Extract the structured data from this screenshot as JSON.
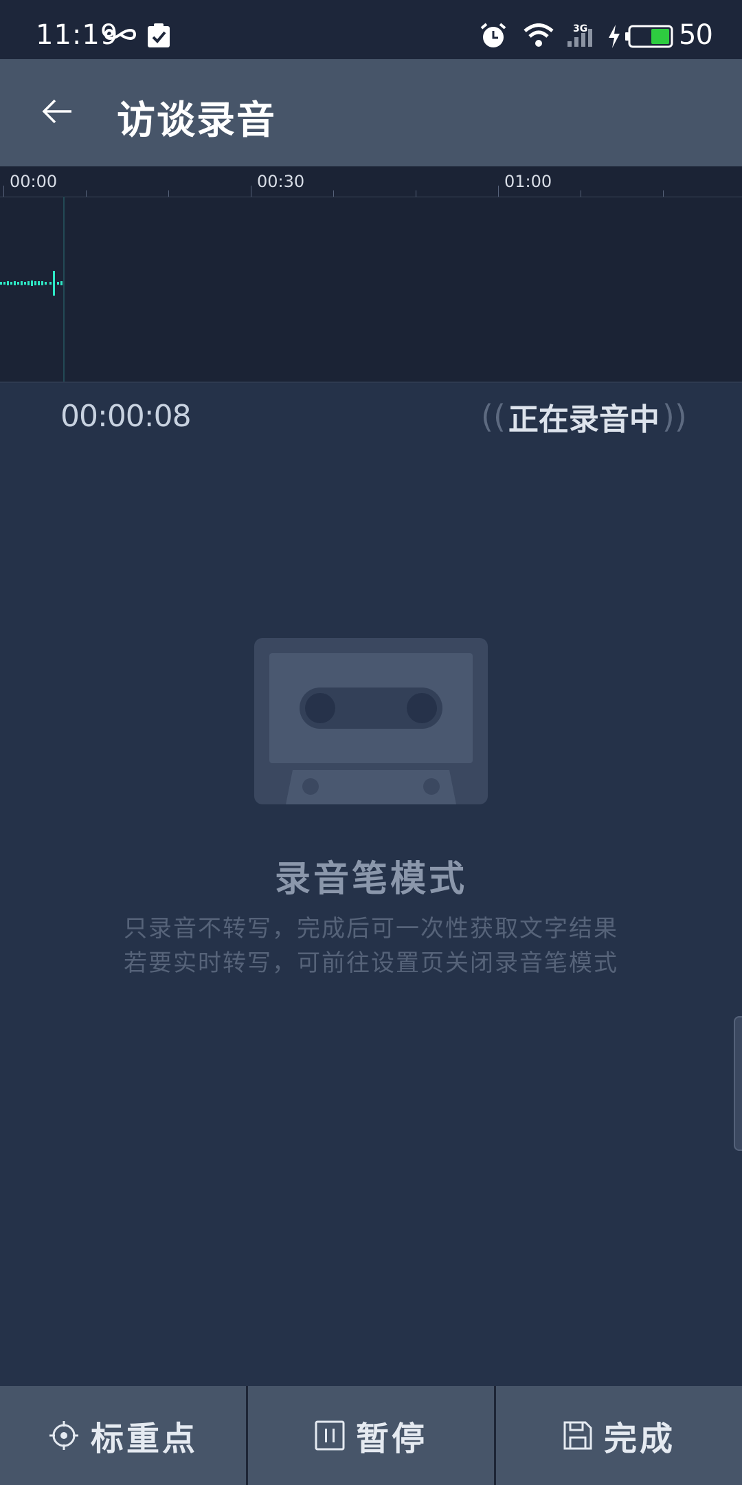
{
  "status_bar": {
    "time": "11:19",
    "network_type": "3G",
    "battery_level": "50",
    "icons": [
      "infinity-icon",
      "clipboard-check-icon",
      "alarm-icon",
      "wifi-icon",
      "signal-icon",
      "charging-icon",
      "battery-icon"
    ],
    "battery_color": "#2ecc40"
  },
  "header": {
    "title": "访谈录音"
  },
  "timeline": {
    "ticks": [
      "00:00",
      "00:30",
      "01:00"
    ],
    "waveform_color": "#2ee8c5"
  },
  "recording": {
    "elapsed": "00:00:08",
    "status_label": "正在录音中",
    "wave_left": "((",
    "wave_right": "))"
  },
  "mode": {
    "title": "录音笔模式",
    "desc_line1": "只录音不转写，完成后可一次性获取文字结果",
    "desc_line2": "若要实时转写，可前往设置页关闭录音笔模式"
  },
  "bottom_bar": {
    "mark_label": "标重点",
    "pause_label": "暂停",
    "done_label": "完成"
  },
  "colors": {
    "background": "#253249",
    "header": "#475569",
    "status_bar": "#1d263a",
    "timeline": "#1b2335",
    "accent": "#2ee8c5"
  }
}
